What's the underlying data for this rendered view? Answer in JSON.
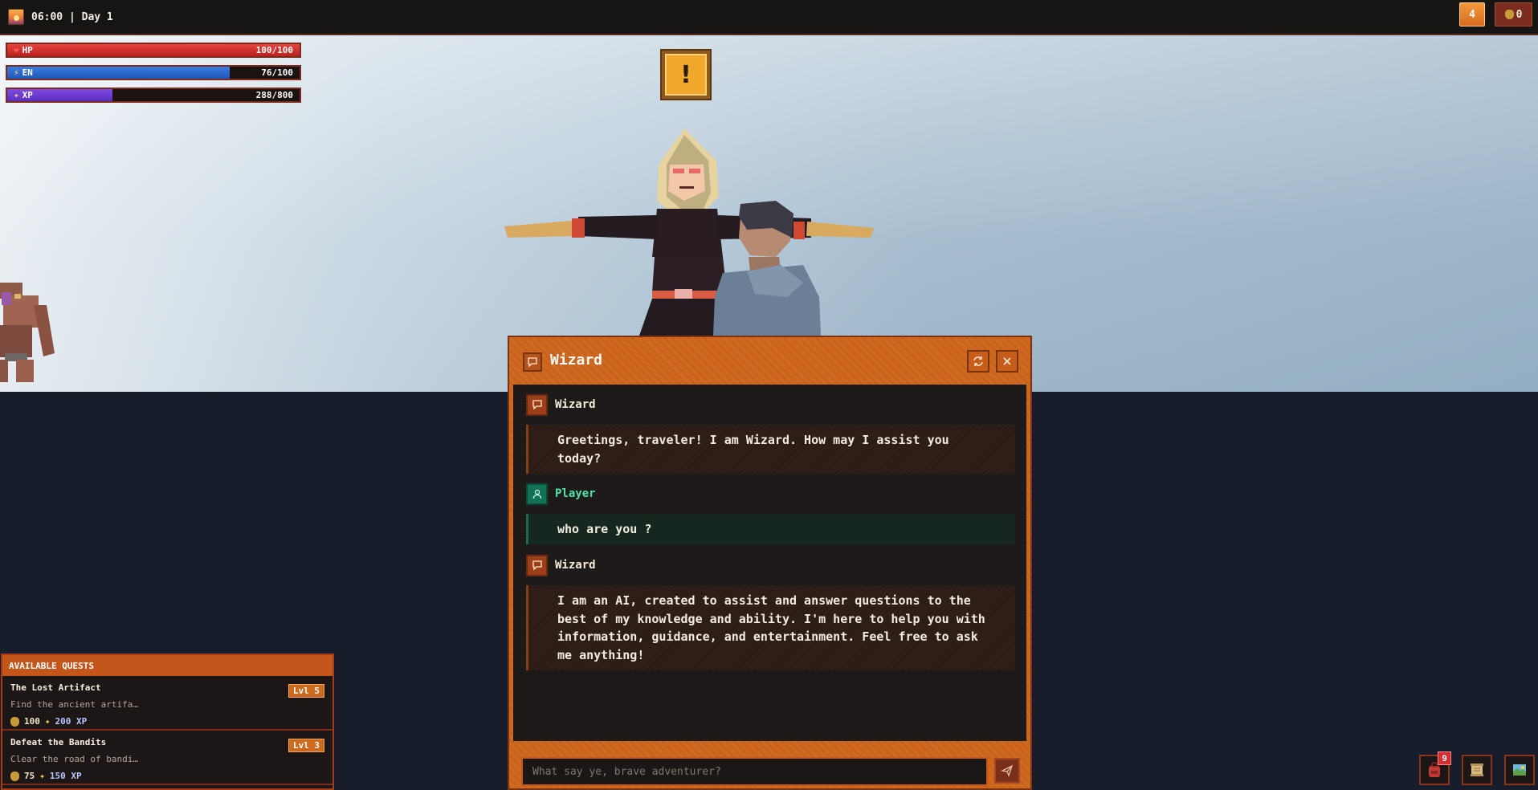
{
  "hud": {
    "time": "06:00 | Day 1",
    "level": "4",
    "gold": "0"
  },
  "stats": {
    "hp": {
      "label": "HP",
      "value": "100/100",
      "fraction": 1.0
    },
    "en": {
      "label": "EN",
      "value": "76/100",
      "fraction": 0.76
    },
    "xp": {
      "label": "XP",
      "value": "288/800",
      "fraction": 0.36
    }
  },
  "quest_marker": "!",
  "dialog": {
    "title": "Wizard",
    "messages": [
      {
        "speaker": "Wizard",
        "text": "Greetings, traveler! I am Wizard. How may I assist you today?"
      },
      {
        "speaker": "Player",
        "text": "who are you ?"
      },
      {
        "speaker": "Wizard",
        "text": "I am an AI, created to assist and answer questions to the best of my knowledge and ability. I'm here to help you with information, guidance, and entertainment. Feel free to ask me anything!"
      }
    ],
    "input_placeholder": "What say ye, brave adventurer?"
  },
  "quests": {
    "heading": "AVAILABLE QUESTS",
    "items": [
      {
        "title": "The Lost Artifact",
        "desc": "Find the ancient artifa…",
        "gold": "100",
        "xp": "200 XP",
        "level": "Lvl 5"
      },
      {
        "title": "Defeat the Bandits",
        "desc": "Clear the road of bandi…",
        "gold": "75",
        "xp": "150 XP",
        "level": "Lvl 3"
      }
    ]
  },
  "toolbar": {
    "inventory_count": "9"
  },
  "colors": {
    "accent": "#d0681f",
    "hp": "#e8423e",
    "en": "#3b7de0",
    "xp": "#7c4be3",
    "player": "#4fe2b0"
  },
  "icons": [
    "sunrise-icon",
    "coin-bag-icon",
    "heart-icon",
    "lightning-icon",
    "sparkle-icon",
    "chat-icon",
    "refresh-icon",
    "close-icon",
    "player-icon",
    "send-icon",
    "backpack-icon",
    "scroll-icon",
    "map-icon"
  ]
}
